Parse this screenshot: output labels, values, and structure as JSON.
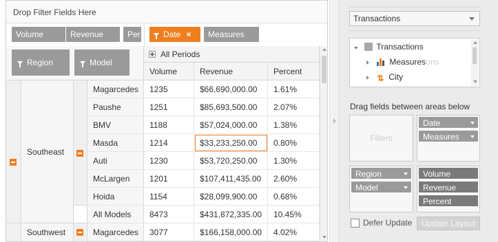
{
  "grid": {
    "filter_drop_text": "Drop Filter Fields Here",
    "column_chips": [
      "Volume",
      "Revenue",
      "Per"
    ],
    "column_area_chips": [
      {
        "label": "Date",
        "highlight": true,
        "removable": true
      },
      {
        "label": "Measures",
        "highlight": false,
        "removable": false
      }
    ],
    "row_chips": [
      "Region",
      "Model"
    ],
    "all_periods": "All Periods",
    "headers": [
      "Volume",
      "Revenue",
      "Percent"
    ],
    "groups": [
      {
        "region": "Southeast",
        "rows": [
          {
            "model": "Magarcedes",
            "volume": "1235",
            "revenue": "$66,690,000.00",
            "percent": "1.61%"
          },
          {
            "model": "Paushe",
            "volume": "1251",
            "revenue": "$85,693,500.00",
            "percent": "2.07%"
          },
          {
            "model": "BMV",
            "volume": "1188",
            "revenue": "$57,024,000.00",
            "percent": "1.38%"
          },
          {
            "model": "Masda",
            "volume": "1214",
            "revenue": "$33,233,250.00",
            "percent": "0.80%"
          },
          {
            "model": "Auti",
            "volume": "1230",
            "revenue": "$53,720,250.00",
            "percent": "1.30%"
          },
          {
            "model": "McLargen",
            "volume": "1201",
            "revenue": "$107,411,435.00",
            "percent": "2.60%"
          },
          {
            "model": "Hoida",
            "volume": "1154",
            "revenue": "$28,099,900.00",
            "percent": "0.68%"
          },
          {
            "model": "All Models",
            "volume": "8473",
            "revenue": "$431,872,335.00",
            "percent": "10.45%"
          }
        ]
      },
      {
        "region": "Southwest",
        "rows": [
          {
            "model": "Magarcedes",
            "volume": "3077",
            "revenue": "$166,158,000.00",
            "percent": "4.02%"
          }
        ]
      }
    ],
    "selected_cell_color": "#f07f1f"
  },
  "panel": {
    "cube_select": "Transactions",
    "tree": {
      "root": "Transactions",
      "children": [
        "Measures",
        "City"
      ],
      "ghost": "ons"
    },
    "drag_hint": "Drag fields between areas below",
    "filters_label": "Filters",
    "columns_area": [
      "Date",
      "Measures"
    ],
    "rows_area": [
      "Region",
      "Model"
    ],
    "values_area": [
      "Volume",
      "Revenue",
      "Percent"
    ],
    "defer_label": "Defer Update",
    "update_button": "Update Layout"
  },
  "colors": {
    "accent": "#f07f1f",
    "chip": "#9a9a9a",
    "panel_bg": "#ebebeb"
  }
}
